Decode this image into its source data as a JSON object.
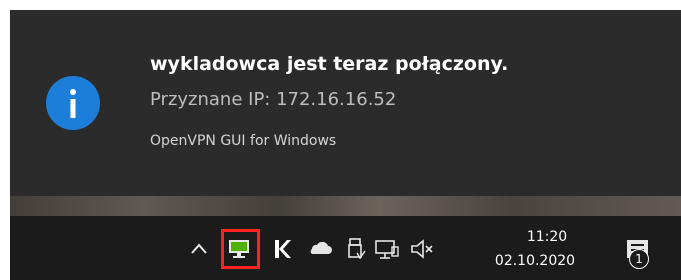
{
  "notification": {
    "title": "wykladowca jest teraz połączony.",
    "message": "Przyznane IP: 172.16.16.52",
    "source": "OpenVPN GUI for Windows",
    "icon": "info-icon",
    "accent_color": "#1c7ed8"
  },
  "taskbar": {
    "time": "11:20",
    "date": "02.10.2020",
    "notification_count": "1",
    "highlight_color": "#ff2020",
    "tray_icons": [
      "show-hidden-icons-chevron",
      "openvpn-connected-icon",
      "k-icon",
      "onedrive-cloud-icon",
      "usb-safely-remove-icon",
      "network-icon",
      "volume-muted-icon",
      "action-center-icon"
    ]
  }
}
